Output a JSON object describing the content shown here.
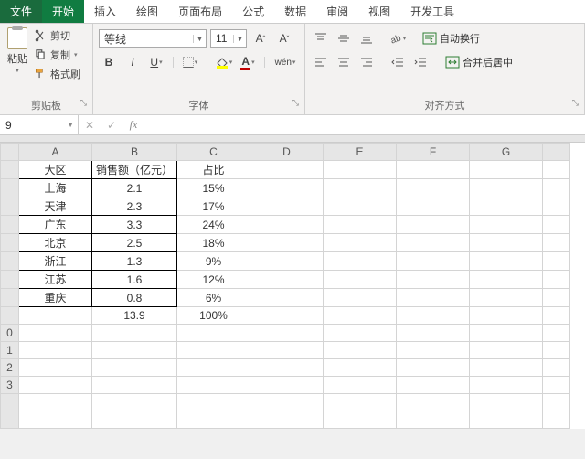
{
  "tabs": {
    "file": "文件",
    "home": "开始",
    "insert": "插入",
    "draw": "绘图",
    "layout": "页面布局",
    "formulas": "公式",
    "data": "数据",
    "review": "审阅",
    "view": "视图",
    "dev": "开发工具"
  },
  "ribbon": {
    "clipboard": {
      "paste": "粘贴",
      "cut": "剪切",
      "copy": "复制",
      "format_painter": "格式刷",
      "label": "剪贴板"
    },
    "font": {
      "name": "等线",
      "size": "11",
      "label": "字体",
      "wen": "wén"
    },
    "align": {
      "wrap": "自动换行",
      "merge": "合并后居中",
      "label": "对齐方式"
    }
  },
  "formula_bar": {
    "name_box": "9",
    "fx": "fx"
  },
  "grid": {
    "cols": [
      "A",
      "B",
      "C",
      "D",
      "E",
      "F",
      "G"
    ],
    "header": {
      "A": "大区",
      "B": "销售额（亿元）",
      "C": "占比"
    },
    "rows": [
      {
        "A": "上海",
        "B": "2.1",
        "C": "15%"
      },
      {
        "A": "天津",
        "B": "2.3",
        "C": "17%"
      },
      {
        "A": "广东",
        "B": "3.3",
        "C": "24%"
      },
      {
        "A": "北京",
        "B": "2.5",
        "C": "18%"
      },
      {
        "A": "浙江",
        "B": "1.3",
        "C": "9%"
      },
      {
        "A": "江苏",
        "B": "1.6",
        "C": "12%"
      },
      {
        "A": "重庆",
        "B": "0.8",
        "C": "6%"
      }
    ],
    "total": {
      "B": "13.9",
      "C": "100%"
    },
    "extra_rownums": [
      "0",
      "1",
      "2",
      "3"
    ]
  },
  "chart_data": {
    "type": "table",
    "title": "销售额（亿元）按大区",
    "columns": [
      "大区",
      "销售额（亿元）",
      "占比"
    ],
    "rows": [
      [
        "上海",
        2.1,
        "15%"
      ],
      [
        "天津",
        2.3,
        "17%"
      ],
      [
        "广东",
        3.3,
        "24%"
      ],
      [
        "北京",
        2.5,
        "18%"
      ],
      [
        "浙江",
        1.3,
        "9%"
      ],
      [
        "江苏",
        1.6,
        "12%"
      ],
      [
        "重庆",
        0.8,
        "6%"
      ]
    ],
    "totals": {
      "销售额（亿元）": 13.9,
      "占比": "100%"
    }
  }
}
